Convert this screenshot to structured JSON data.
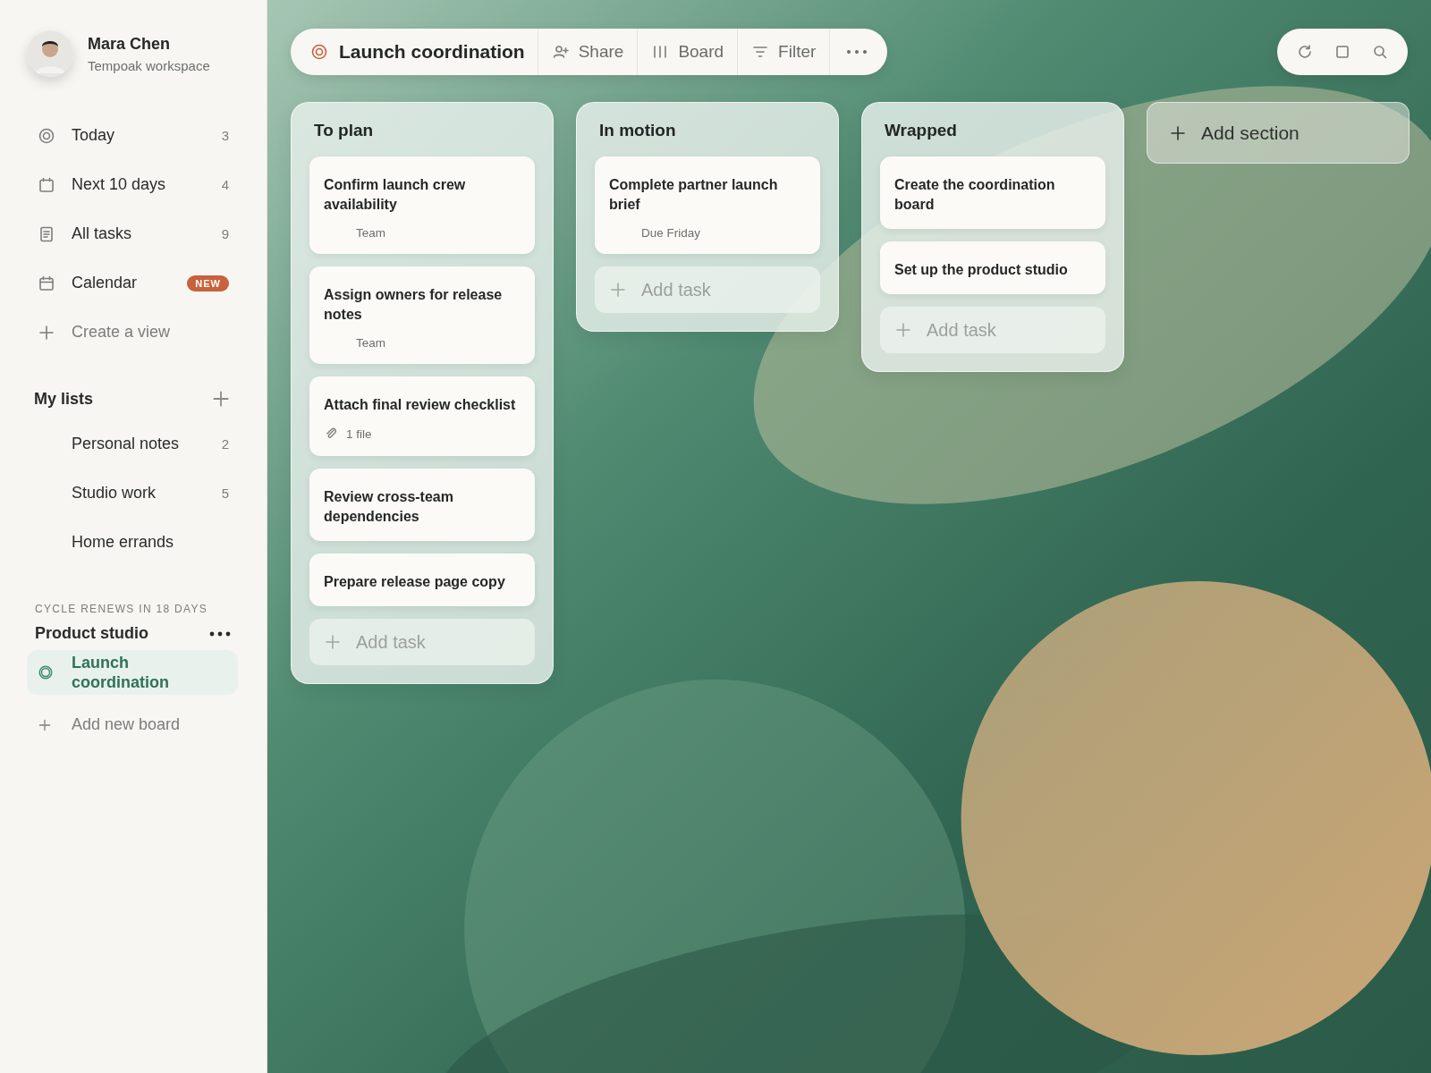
{
  "profile": {
    "name": "Mara Chen",
    "workspace": "Tempoak workspace"
  },
  "nav": [
    {
      "kind": "view",
      "label": "Today",
      "count": "3"
    },
    {
      "kind": "view",
      "label": "Next 10 days",
      "count": "4"
    },
    {
      "kind": "view",
      "label": "All tasks",
      "count": "9"
    },
    {
      "kind": "view",
      "label": "Calendar",
      "badge": "NEW"
    },
    {
      "kind": "action",
      "label": "Create a view"
    }
  ],
  "lists": {
    "title": "My lists",
    "items": [
      {
        "label": "Personal notes",
        "count": "2"
      },
      {
        "label": "Studio work",
        "count": "5"
      },
      {
        "label": "Home errands"
      }
    ]
  },
  "cycle": {
    "note": "CYCLE RENEWS IN 18 DAYS",
    "project": "Product studio",
    "boards": [
      {
        "label": "Launch coordination",
        "selected": true
      }
    ],
    "add": "Add new board"
  },
  "toolbar": {
    "title": "Launch coordination",
    "actions": [
      "Share",
      "Board",
      "Filter"
    ]
  },
  "columns": [
    {
      "title": "To plan",
      "add": "Add task",
      "cards": [
        {
          "title": "Confirm launch crew availability",
          "meta": {
            "kind": "label",
            "text": "Team"
          }
        },
        {
          "title": "Assign owners for release notes",
          "meta": {
            "kind": "label",
            "text": "Team"
          }
        },
        {
          "title": "Attach final review checklist",
          "meta": {
            "kind": "attachment",
            "text": "1 file"
          }
        },
        {
          "title": "Review cross-team dependencies"
        },
        {
          "title": "Prepare release page copy"
        }
      ]
    },
    {
      "title": "In motion",
      "add": "Add task",
      "cards": [
        {
          "title": "Complete partner launch brief",
          "meta": {
            "kind": "label",
            "text": "Due Friday"
          }
        }
      ]
    },
    {
      "title": "Wrapped",
      "add": "Add task",
      "cards": [
        {
          "title": "Create the coordination board"
        },
        {
          "title": "Set up the product studio"
        }
      ]
    }
  ],
  "add_section": "Add section"
}
